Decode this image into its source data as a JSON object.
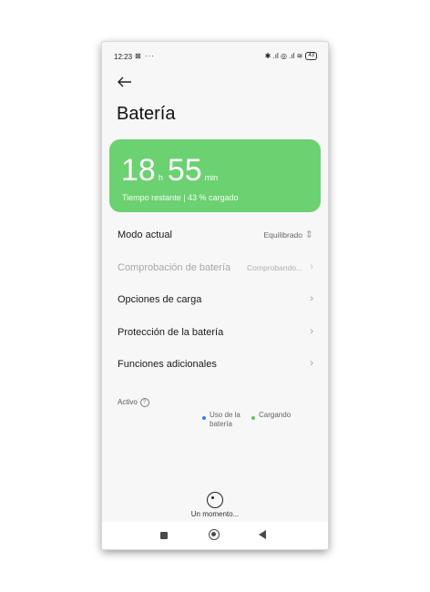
{
  "status_bar": {
    "time": "12:23",
    "left_icons": "⊠ ···",
    "right_icons": "✱ .ıl ◎ .ıl ≋",
    "battery_level": "43"
  },
  "header": {
    "back_icon": "arrow-left-icon",
    "title": "Batería"
  },
  "battery_card": {
    "hours": "18",
    "hours_unit": "h",
    "minutes": "55",
    "minutes_unit": "min",
    "subtitle": "Tiempo restante | 43 % cargado",
    "color": "#6bd171"
  },
  "settings": {
    "mode": {
      "label": "Modo actual",
      "value": "Equilibrado",
      "icon": "⇕"
    },
    "check": {
      "label": "Comprobación de batería",
      "value": "Comprobando...",
      "icon": "›"
    },
    "charging": {
      "label": "Opciones de carga",
      "icon": "›"
    },
    "protection": {
      "label": "Protección de la batería",
      "icon": "›"
    },
    "additional": {
      "label": "Funciones adicionales",
      "icon": "›"
    }
  },
  "usage": {
    "active_label": "Activo",
    "help_glyph": "?",
    "legend": [
      {
        "label": "Uso de la batería",
        "color": "#3b7fe0"
      },
      {
        "label": "Cargando",
        "color": "#5ac560"
      }
    ]
  },
  "loading": {
    "text": "Un momento..."
  },
  "navbar": {
    "recents_icon": "square-icon",
    "home_icon": "circle-icon",
    "back_icon": "triangle-left-icon"
  }
}
